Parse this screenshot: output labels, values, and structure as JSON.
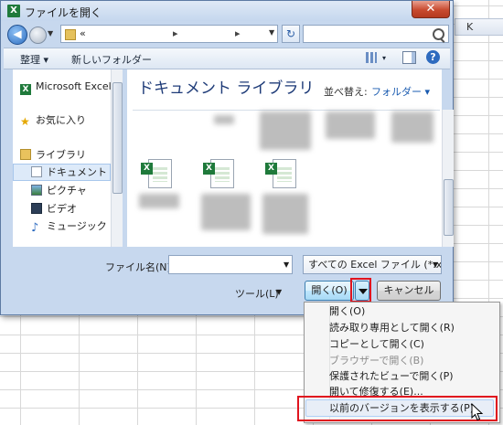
{
  "window": {
    "title": "ファイルを開く",
    "close_glyph": "✕",
    "app_icon_letter": "X"
  },
  "excel_bg": {
    "column_label": "K"
  },
  "address": {
    "chevron": "«",
    "separators": [
      "▸",
      "▸"
    ],
    "search_placeholder": ""
  },
  "toolbar": {
    "organize_label": "整理 ▾",
    "new_folder_label": "新しいフォルダー",
    "view_dropdown": "▾"
  },
  "nav": {
    "items": [
      {
        "label": "Microsoft Excel",
        "icon": "excel-icon"
      },
      {
        "label": "お気に入り",
        "icon": "star-icon"
      },
      {
        "label": "ライブラリ",
        "icon": "library-icon"
      },
      {
        "label": "ドキュメント",
        "icon": "document-icon"
      },
      {
        "label": "ピクチャ",
        "icon": "picture-icon"
      },
      {
        "label": "ビデオ",
        "icon": "video-icon"
      },
      {
        "label": "ミュージック",
        "icon": "music-icon"
      }
    ],
    "selected": "ドキュメント"
  },
  "main": {
    "library_title": "ドキュメント ライブラリ",
    "sort_label": "並べ替え:",
    "sort_value": "フォルダー ▾"
  },
  "bottom": {
    "filename_label": "ファイル名(N):",
    "filename_value": "",
    "filetype_value": "すべての Excel ファイル (*.xl",
    "tools_label": "ツール(L)",
    "open_label": "開く(O)",
    "cancel_label": "キャンセル"
  },
  "menu": {
    "items": [
      {
        "label": "開く(O)",
        "enabled": true
      },
      {
        "label": "読み取り専用として開く(R)",
        "enabled": true
      },
      {
        "label": "コピーとして開く(C)",
        "enabled": true
      },
      {
        "label": "ブラウザーで開く(B)",
        "enabled": false
      },
      {
        "label": "保護されたビューで開く(P)",
        "enabled": true
      },
      {
        "label": "開いて修復する(E)...",
        "enabled": true
      },
      {
        "label": "以前のバージョンを表示する(P)",
        "enabled": true
      }
    ],
    "highlighted_index": 6
  },
  "colors": {
    "highlight_border": "#e0141e",
    "excel_green": "#1f7a3b",
    "library_title": "#1e3b78"
  }
}
